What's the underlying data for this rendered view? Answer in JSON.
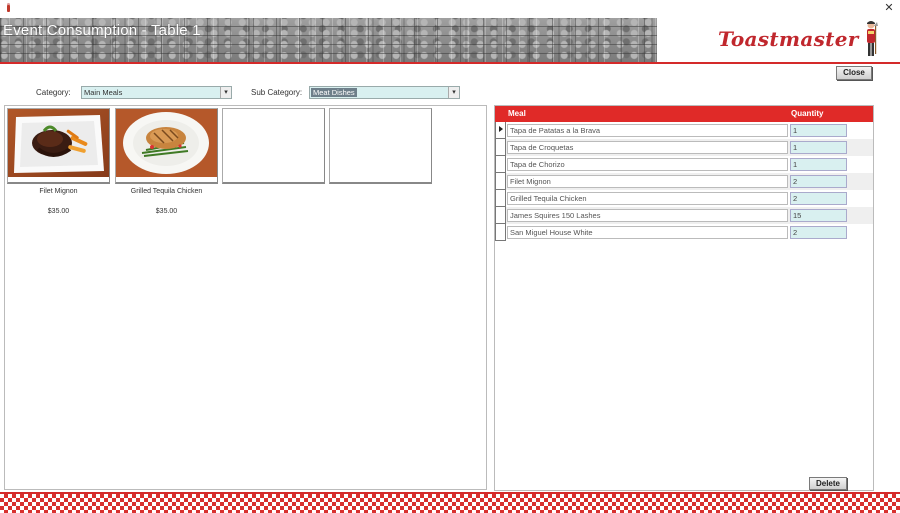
{
  "window": {
    "close_glyph": "✕",
    "app_icon": "toastmaster-figure-icon"
  },
  "header": {
    "title": "Event Consumption - Table 1",
    "brand": "Toastmaster",
    "accent_color": "#d42a2a"
  },
  "toolbar": {
    "close_label": "Close",
    "delete_label": "Delete"
  },
  "filters": {
    "category_label": "Category:",
    "category_value": "Main Meals",
    "subcategory_label": "Sub Category:",
    "subcategory_value": "Meat Dishes"
  },
  "menu_items": [
    {
      "name": "Filet Mignon",
      "price": "$35.00",
      "image": "filet-mignon-photo"
    },
    {
      "name": "Grilled Tequila Chicken",
      "price": "$35.00",
      "image": "grilled-chicken-photo"
    },
    {
      "name": "",
      "price": "",
      "image": ""
    },
    {
      "name": "",
      "price": "",
      "image": ""
    }
  ],
  "consumption_table": {
    "columns": [
      "Meal",
      "Quantity"
    ],
    "rows": [
      {
        "meal": "Tapa de Patatas a la Brava",
        "quantity": "1"
      },
      {
        "meal": "Tapa de Croquetas",
        "quantity": "1"
      },
      {
        "meal": "Tapa de Chorizo",
        "quantity": "1"
      },
      {
        "meal": "Filet Mignon",
        "quantity": "2"
      },
      {
        "meal": "Grilled Tequila Chicken",
        "quantity": "2"
      },
      {
        "meal": "James Squires 150 Lashes",
        "quantity": "15"
      },
      {
        "meal": "San Miguel House White",
        "quantity": "2"
      }
    ]
  }
}
